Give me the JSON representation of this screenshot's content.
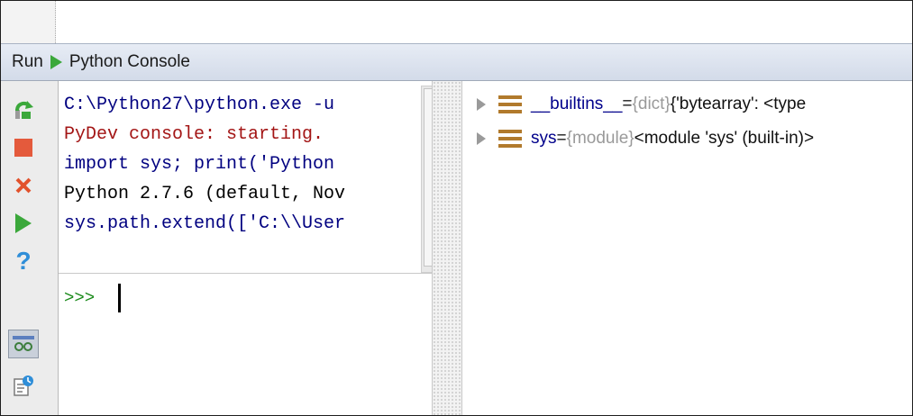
{
  "run_panel": {
    "tab_prefix": "Run",
    "console_name": "Python Console"
  },
  "toolbar": {
    "buttons": [
      {
        "name": "rerun",
        "icon": "rerun-icon"
      },
      {
        "name": "stop",
        "icon": "stop-icon"
      },
      {
        "name": "close",
        "icon": "close-icon"
      },
      {
        "name": "execute",
        "icon": "run-icon"
      },
      {
        "name": "help",
        "icon": "help-icon",
        "label": "?"
      },
      {
        "name": "show-variables",
        "icon": "variables-view-icon",
        "pressed": true
      },
      {
        "name": "history",
        "icon": "history-icon"
      }
    ]
  },
  "console": {
    "lines": [
      {
        "text": "C:\\Python27\\python.exe -u",
        "color": "#000080"
      },
      {
        "text": "PyDev console: starting.",
        "color": "#a31515"
      },
      {
        "text": "import sys; print('Python",
        "color": "#000080"
      },
      {
        "text": "Python 2.7.6 (default, Nov",
        "color": "#000000"
      },
      {
        "text": "sys.path.extend(['C:\\\\User",
        "color": "#000080"
      }
    ],
    "prompt": ">>>"
  },
  "variables": [
    {
      "name": "__builtins__",
      "eq": " = ",
      "type": "{dict}",
      "value": " {'bytearray': <type"
    },
    {
      "name": "sys",
      "eq": " = ",
      "type": "{module}",
      "value": " <module 'sys' (built-in)>"
    }
  ],
  "colors": {
    "accent_play": "#3ba83b",
    "stop": "#e45a3c",
    "close": "#e2522c",
    "help": "#2f8ed8",
    "var_icon": "#b17a2c"
  }
}
